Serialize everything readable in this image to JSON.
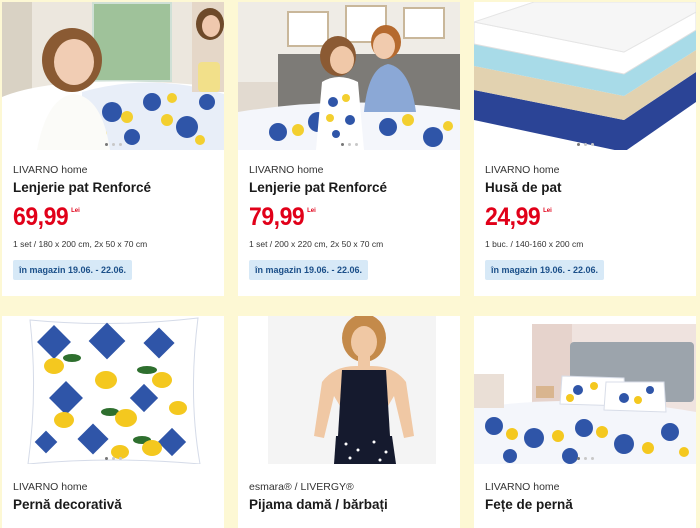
{
  "products": [
    {
      "brand": "LIVARNO home",
      "title": "Lenjerie pat Renforcé",
      "price": "69,99",
      "currency": "Lei",
      "pack": "1 set / 180 x 200 cm, 2x 50 x 70 cm",
      "availability": "în magazin 19.06. - 22.06."
    },
    {
      "brand": "LIVARNO home",
      "title": "Lenjerie pat Renforcé",
      "price": "79,99",
      "currency": "Lei",
      "pack": "1 set / 200 x 220 cm, 2x 50 x 70 cm",
      "availability": "în magazin 19.06. - 22.06."
    },
    {
      "brand": "LIVARNO home",
      "title": "Husă de pat",
      "price": "24,99",
      "currency": "Lei",
      "pack": "1 buc. / 140-160 x 200 cm",
      "availability": "în magazin 19.06. - 22.06."
    },
    {
      "brand": "LIVARNO home",
      "title": "Pernă decorativă"
    },
    {
      "brand": "esmara® / LIVERGY®",
      "title": "Pijama damă / bărbați"
    },
    {
      "brand": "LIVARNO home",
      "title": "Fețe de pernă"
    }
  ],
  "colors": {
    "page_bg": "#fdf8d4",
    "price_red": "#e10019",
    "badge_bg": "#d7e9f7",
    "badge_text": "#1b4f89"
  }
}
